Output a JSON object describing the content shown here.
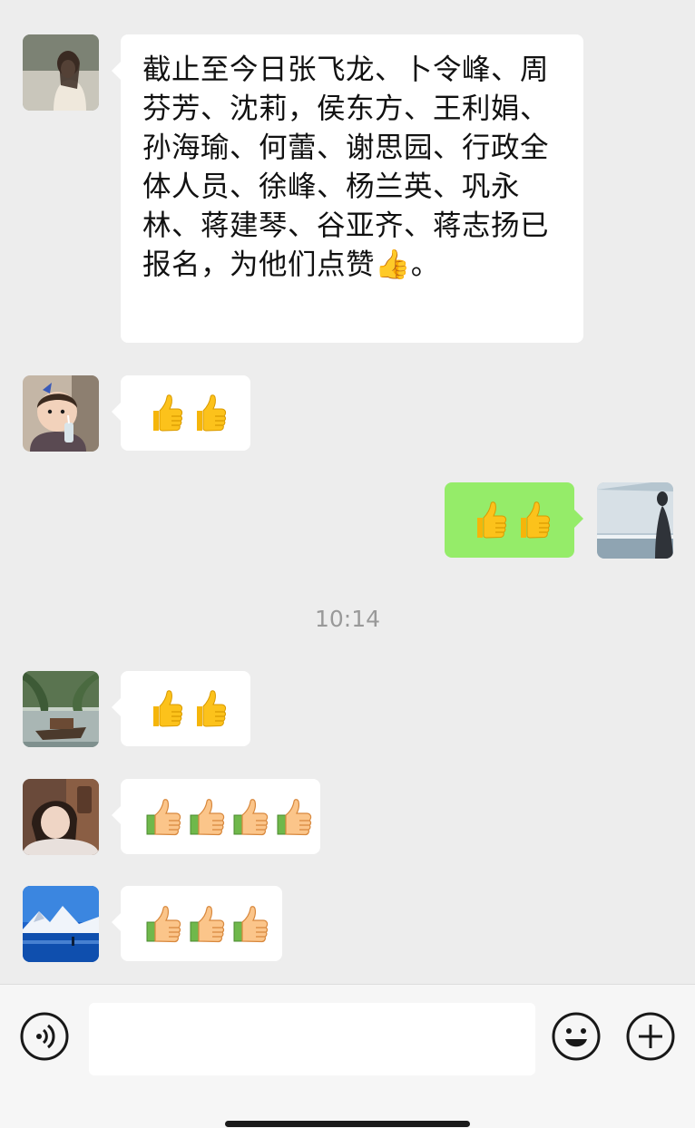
{
  "messages": [
    {
      "side": "left",
      "avatar": "avatar-woman-outdoor",
      "text": "截止至今日张飞龙、卜令峰、周芬芳、沈莉，侯东方、王利娟、孙海瑜、何蕾、谢思园、行政全体人员、徐峰、杨兰英、巩永林、蒋建琴、谷亚齐、蒋志扬已报名，为他们点赞👍。"
    },
    {
      "side": "left",
      "avatar": "avatar-baby",
      "thumbs": 2,
      "thumb_style": "yellow"
    },
    {
      "side": "right",
      "avatar": "avatar-silhouette-sea",
      "thumbs": 2,
      "thumb_style": "yellow"
    },
    {
      "side": "left",
      "avatar": "avatar-willow-boat",
      "thumbs": 2,
      "thumb_style": "yellow"
    },
    {
      "side": "left",
      "avatar": "avatar-woman-selfie",
      "thumbs": 4,
      "thumb_style": "cuff"
    },
    {
      "side": "left",
      "avatar": "avatar-snow-lake",
      "thumbs": 3,
      "thumb_style": "cuff"
    }
  ],
  "timestamp": "10:14",
  "input_bar": {
    "voice_icon": "voice-icon",
    "emoji_icon": "emoji-icon",
    "plus_icon": "plus-icon",
    "text_value": ""
  },
  "colors": {
    "background": "#ededed",
    "incoming_bubble": "#ffffff",
    "outgoing_bubble": "#95ec69",
    "timestamp": "#999999"
  }
}
